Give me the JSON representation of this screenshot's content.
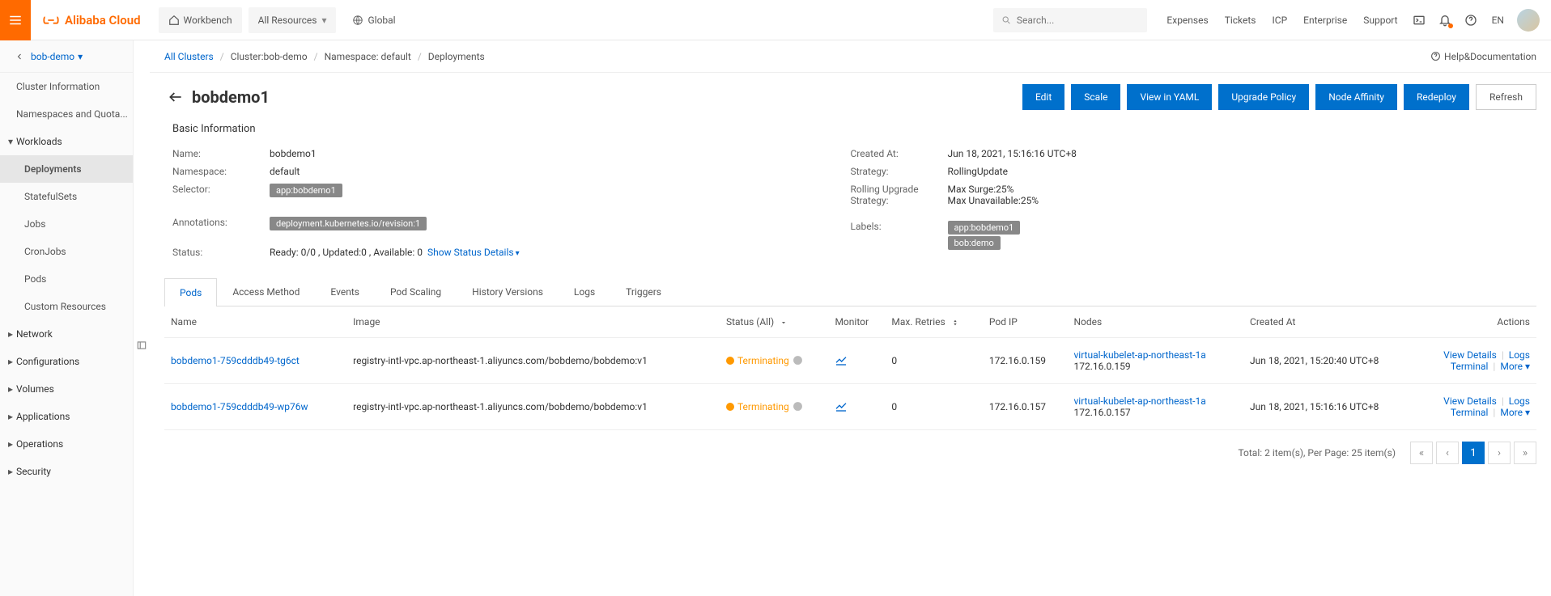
{
  "top": {
    "brand": "Alibaba Cloud",
    "workbench": "Workbench",
    "allResources": "All Resources",
    "global": "Global",
    "searchPlaceholder": "Search...",
    "links": [
      "Expenses",
      "Tickets",
      "ICP",
      "Enterprise",
      "Support"
    ],
    "lang": "EN"
  },
  "sidebar": {
    "back": "bob-demo",
    "items": [
      {
        "label": "Cluster Information",
        "type": "item"
      },
      {
        "label": "Namespaces and Quota...",
        "type": "item"
      },
      {
        "label": "Workloads",
        "type": "group",
        "open": true
      },
      {
        "label": "Deployments",
        "type": "sub",
        "active": true
      },
      {
        "label": "StatefulSets",
        "type": "sub"
      },
      {
        "label": "Jobs",
        "type": "sub"
      },
      {
        "label": "CronJobs",
        "type": "sub"
      },
      {
        "label": "Pods",
        "type": "sub"
      },
      {
        "label": "Custom Resources",
        "type": "sub"
      },
      {
        "label": "Network",
        "type": "group"
      },
      {
        "label": "Configurations",
        "type": "group"
      },
      {
        "label": "Volumes",
        "type": "group"
      },
      {
        "label": "Applications",
        "type": "group"
      },
      {
        "label": "Operations",
        "type": "group"
      },
      {
        "label": "Security",
        "type": "group"
      }
    ]
  },
  "breadcrumb": {
    "items": [
      "All Clusters",
      "Cluster:bob-demo",
      "Namespace: default",
      "Deployments"
    ],
    "help": "Help&Documentation"
  },
  "page": {
    "title": "bobdemo1",
    "actions": [
      "Edit",
      "Scale",
      "View in YAML",
      "Upgrade Policy",
      "Node Affinity",
      "Redeploy"
    ],
    "refresh": "Refresh"
  },
  "basic": {
    "heading": "Basic Information",
    "left": {
      "nameLabel": "Name:",
      "name": "bobdemo1",
      "nsLabel": "Namespace:",
      "ns": "default",
      "selLabel": "Selector:",
      "selTag": "app:bobdemo1",
      "annLabel": "Annotations:",
      "annTag": "deployment.kubernetes.io/revision:1",
      "statusLabel": "Status:",
      "status": "Ready: 0/0 ,  Updated:0 ,  Available: 0",
      "statusLink": "Show Status Details"
    },
    "right": {
      "createdLabel": "Created At:",
      "created": "Jun 18, 2021, 15:16:16 UTC+8",
      "stratLabel": "Strategy:",
      "strat": "RollingUpdate",
      "rollLabel": "Rolling Upgrade Strategy:",
      "roll1": "Max Surge:25%",
      "roll2": "Max Unavailable:25%",
      "labelsLabel": "Labels:",
      "label1": "app:bobdemo1",
      "label2": "bob:demo"
    }
  },
  "tabs": [
    "Pods",
    "Access Method",
    "Events",
    "Pod Scaling",
    "History Versions",
    "Logs",
    "Triggers"
  ],
  "table": {
    "headers": {
      "name": "Name",
      "image": "Image",
      "status": "Status (All)",
      "monitor": "Monitor",
      "retries": "Max. Retries",
      "podip": "Pod IP",
      "nodes": "Nodes",
      "created": "Created At",
      "actions": "Actions"
    },
    "rows": [
      {
        "name": "bobdemo1-759cdddb49-tg6ct",
        "image": "registry-intl-vpc.ap-northeast-1.aliyuncs.com/bobdemo/bobdemo:v1",
        "status": "Terminating",
        "retries": "0",
        "podip": "172.16.0.159",
        "node": "virtual-kubelet-ap-northeast-1a",
        "nodeip": "172.16.0.159",
        "created": "Jun 18, 2021, 15:20:40 UTC+8"
      },
      {
        "name": "bobdemo1-759cdddb49-wp76w",
        "image": "registry-intl-vpc.ap-northeast-1.aliyuncs.com/bobdemo/bobdemo:v1",
        "status": "Terminating",
        "retries": "0",
        "podip": "172.16.0.157",
        "node": "virtual-kubelet-ap-northeast-1a",
        "nodeip": "172.16.0.157",
        "created": "Jun 18, 2021, 15:16:16 UTC+8"
      }
    ],
    "rowActions": {
      "view": "View Details",
      "logs": "Logs",
      "terminal": "Terminal",
      "more": "More"
    }
  },
  "pager": {
    "info": "Total: 2 item(s), Per Page: 25 item(s)",
    "current": "1"
  }
}
